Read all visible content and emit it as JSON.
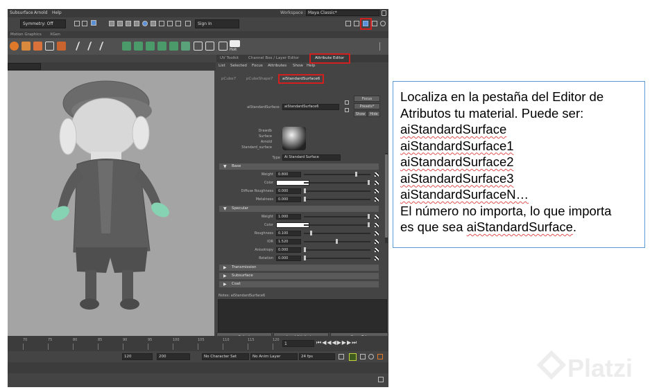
{
  "menubar": {
    "items": [
      "Subsurface",
      "Arnold",
      "Help"
    ],
    "workspace_label": "Workspace :",
    "workspace_value": "Maya Classic*"
  },
  "toolbar": {
    "symmetry": "Symmetry: Off",
    "signin": "Sign In"
  },
  "shelf": {
    "tabs": [
      "Motion Graphics",
      "XGen"
    ],
    "highlight_label": "Holt"
  },
  "attribute_editor": {
    "top_tabs": [
      "UV Toolkit",
      "Channel Box / Layer Editor",
      "Attribute Editor"
    ],
    "menu": [
      "List",
      "Selected",
      "Focus",
      "Attributes",
      "Show",
      "Help"
    ],
    "node_tabs": [
      "pCube7",
      "pCubeShape7",
      "aiStandardSurface6"
    ],
    "node_label": "aiStandardSurface:",
    "node_name": "aiStandardSurface6",
    "focus": "Focus",
    "presets": "Presets*",
    "show": "Show",
    "hide": "Hide",
    "swatch_label": [
      "Drawdb",
      "Surface",
      "Arnold",
      "Standard_surface"
    ],
    "type_label": "Type",
    "type_value": "Ai Standard Surface",
    "base": {
      "title": "Base",
      "rows": [
        {
          "label": "Weight",
          "value": "0.800",
          "fraction": 0.8
        },
        {
          "label": "Color",
          "value": "",
          "fraction": 1.0
        },
        {
          "label": "Diffuse Roughness",
          "value": "0.000",
          "fraction": 0.0
        },
        {
          "label": "Metalness",
          "value": "0.000",
          "fraction": 0.0
        }
      ]
    },
    "specular": {
      "title": "Specular",
      "rows": [
        {
          "label": "Weight",
          "value": "1.000",
          "fraction": 1.0
        },
        {
          "label": "Color",
          "value": "",
          "fraction": 1.0
        },
        {
          "label": "Roughness",
          "value": "0.100",
          "fraction": 0.1
        },
        {
          "label": "IOR",
          "value": "1.520",
          "fraction": 0.5
        },
        {
          "label": "Anisotropy",
          "value": "0.000",
          "fraction": 0.0
        },
        {
          "label": "Rotation",
          "value": "0.000",
          "fraction": 0.0
        }
      ]
    },
    "collapsed_sections": [
      "Transmission",
      "Subsurface",
      "Coat"
    ],
    "notes_label": "Notes: aiStandardSurface6",
    "bottom_buttons": [
      "Select",
      "Load Attributes",
      "Copy Tab"
    ]
  },
  "timeline": {
    "ticks": [
      "70",
      "75",
      "80",
      "85",
      "90",
      "95",
      "100",
      "105",
      "110",
      "115",
      "120"
    ],
    "current_frame": "1",
    "range_start": "120",
    "range_end": "200",
    "character_set": "No Character Set",
    "anim_layer": "No Anim Layer",
    "fps": "24 fps"
  },
  "note": {
    "line1": "Localiza en la pestaña del Editor de",
    "line2": "Atributos tu material. Puede ser:",
    "items": [
      "aiStandardSurface",
      "aiStandardSurface1",
      "aiStandardSurface2",
      "aiStandardSurface3",
      "aiStandardSurfaceN…"
    ],
    "line3": "El número no importa, lo que importa",
    "line4_prefix": "es que sea ",
    "line4_term": "aiStandardSurface",
    "line4_suffix": "."
  },
  "watermark": "Platzi",
  "colors": {
    "highlight": "#d21f1f",
    "note_border": "#5b9bd5"
  }
}
